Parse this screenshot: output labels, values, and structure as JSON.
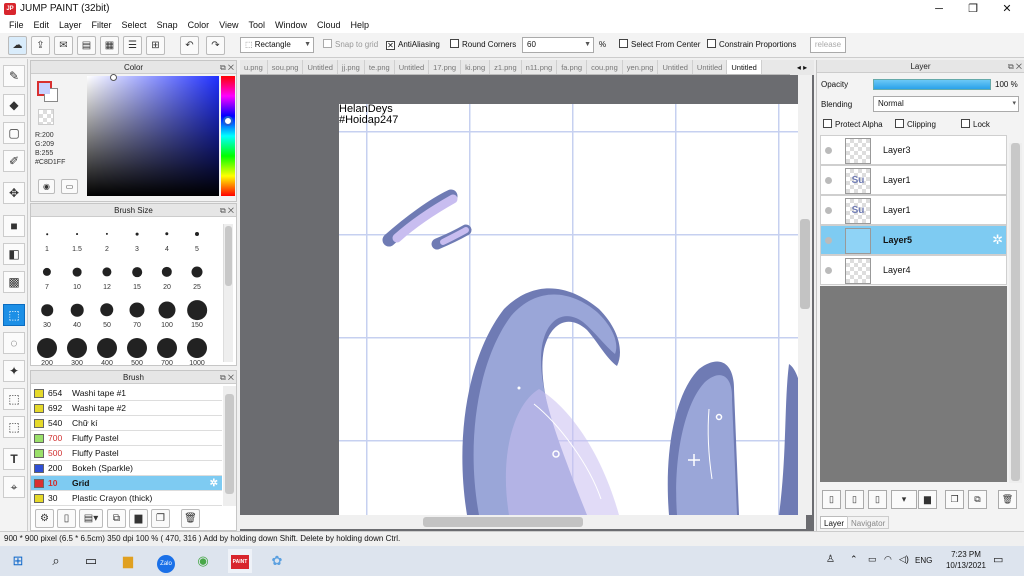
{
  "window": {
    "title": "JUMP PAINT (32bit)",
    "app_badge": "PAINT"
  },
  "menu": [
    "File",
    "Edit",
    "Layer",
    "Filter",
    "Select",
    "Snap",
    "Color",
    "View",
    "Tool",
    "Window",
    "Cloud",
    "Help"
  ],
  "toolbar": {
    "shape_select": "Rectangle",
    "snap_to_grid": "Snap to grid",
    "antialiasing": "AntiAliasing",
    "round_corners": "Round Corners",
    "round_value": "60",
    "percent": "%",
    "select_from_center": "Select From Center",
    "constrain_proportions": "Constrain Proportions",
    "release": "release"
  },
  "color_panel": {
    "title": "Color",
    "r": "R:200",
    "g": "G:209",
    "b": "B:255",
    "hex": "#C8D1FF",
    "current_color": "#C8D1FF"
  },
  "brush_size_panel": {
    "title": "Brush Size",
    "sizes": [
      "1",
      "1.5",
      "2",
      "3",
      "4",
      "5",
      "7",
      "10",
      "12",
      "15",
      "20",
      "25",
      "30",
      "40",
      "50",
      "70",
      "100",
      "150",
      "200",
      "300",
      "400",
      "500",
      "700",
      "1000"
    ]
  },
  "brush_panel": {
    "title": "Brush",
    "items": [
      {
        "num": "654",
        "name": "Washi tape #1",
        "color": "#e5d92a"
      },
      {
        "num": "692",
        "name": "Washi tape #2",
        "color": "#e5d92a"
      },
      {
        "num": "540",
        "name": "Chữ kí",
        "color": "#e5d92a"
      },
      {
        "num": "700",
        "name": "Fluffy Pastel",
        "color": "#9be06a"
      },
      {
        "num": "500",
        "name": "Fluffy Pastel",
        "color": "#9be06a"
      },
      {
        "num": "200",
        "name": "Bokeh (Sparkle)",
        "color": "#2f4fd6"
      },
      {
        "num": "10",
        "name": "Grid",
        "color": "#d93030"
      },
      {
        "num": "30",
        "name": "Plastic Crayon (thick)",
        "color": "#e5d92a"
      }
    ],
    "selected_index": 6
  },
  "tabs": [
    "u.png",
    "sou.png",
    "Untitled",
    "jj.png",
    "te.png",
    "Untitled",
    "17.png",
    "ki.png",
    "z1.png",
    "n11.png",
    "fa.png",
    "cou.png",
    "yen.png",
    "Untitled",
    "Untitled",
    "Untitled"
  ],
  "canvas": {
    "text_line1": "HelanDeys",
    "text_line2": "#Hoidap247"
  },
  "layer_panel": {
    "title": "Layer",
    "opacity_label": "Opacity",
    "opacity_value": "100 %",
    "blending_label": "Blending",
    "blending_value": "Normal",
    "protect_alpha": "Protect Alpha",
    "clipping": "Clipping",
    "lock": "Lock",
    "layers": [
      {
        "name": "Layer3"
      },
      {
        "name": "Layer1"
      },
      {
        "name": "Layer1"
      },
      {
        "name": "Layer5"
      },
      {
        "name": "Layer4"
      }
    ],
    "selected_index": 3,
    "tab_layer": "Layer",
    "tab_navigator": "Navigator"
  },
  "status": {
    "text": "900 * 900 pixel   (6.5 * 6.5cm)   350 dpi   100 %   ( 470, 316 )   Add by holding down Shift. Delete by holding down Ctrl."
  },
  "taskbar": {
    "time": "7:23 PM",
    "date": "10/13/2021",
    "lang": "ENG"
  },
  "colors": {
    "accent_blue": "#1c8fe6",
    "selection": "#7ecbf2",
    "workspace": "#6b6c70",
    "drawing_purple": "#9aa6d8",
    "drawing_dark": "#6f7bb4",
    "drawing_light": "#c8bdf0"
  }
}
